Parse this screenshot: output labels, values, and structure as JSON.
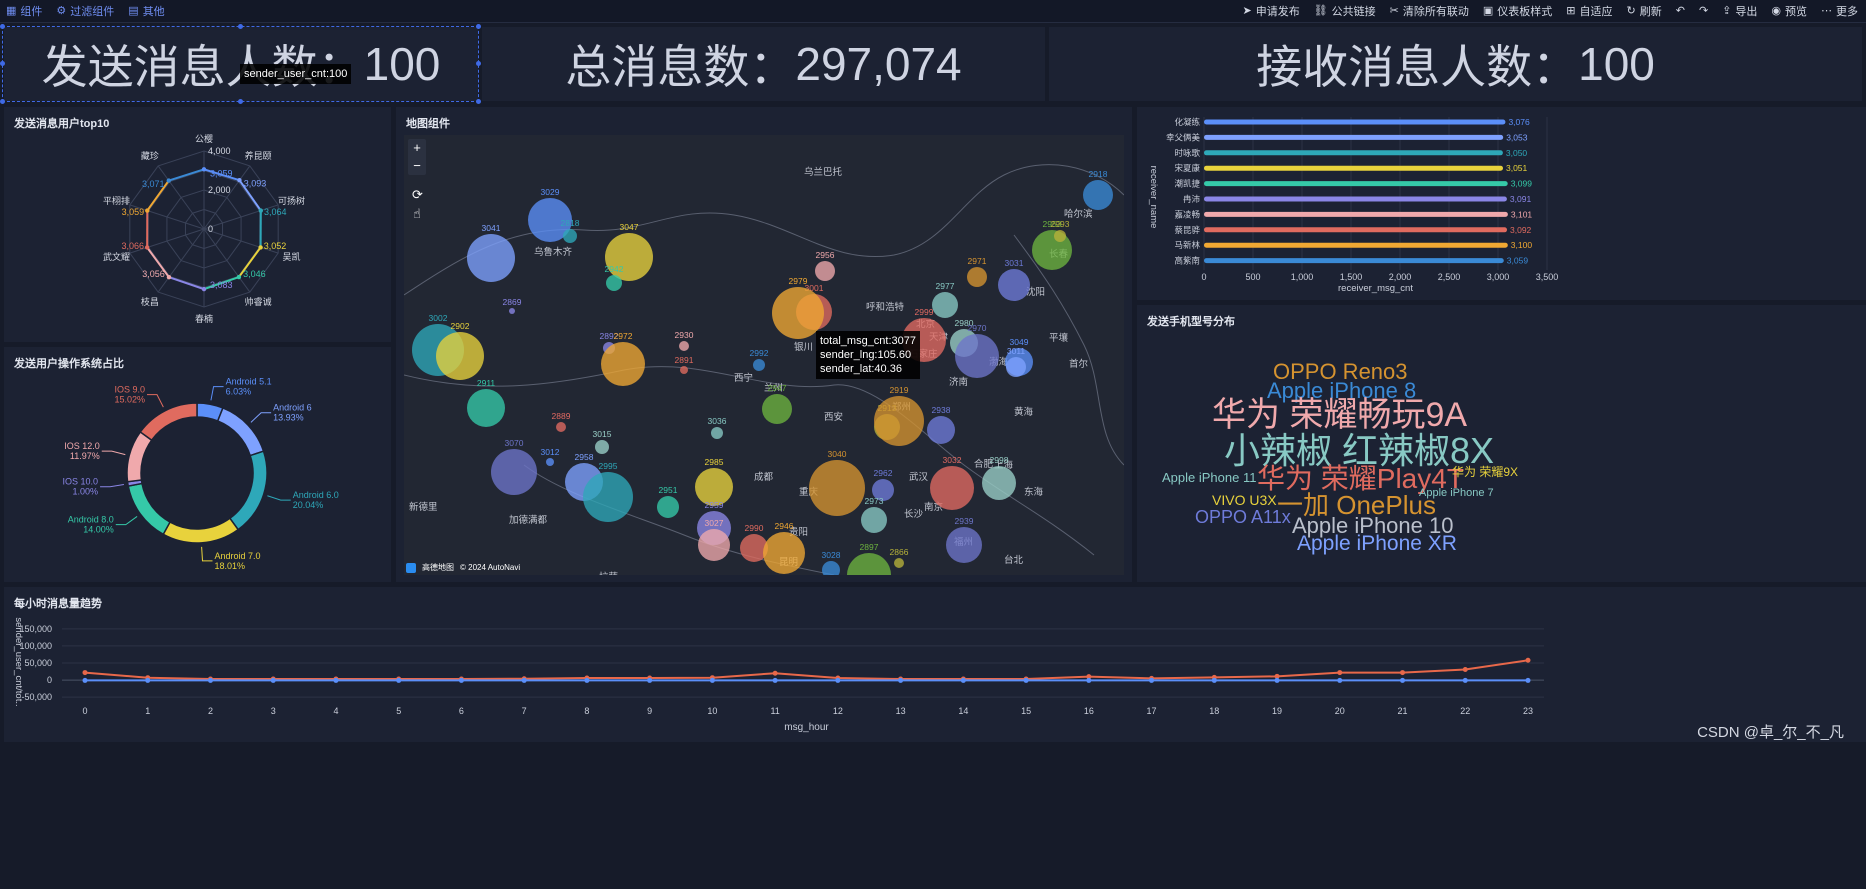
{
  "toolbar": {
    "left": [
      {
        "icon": "component-icon",
        "label": "组件"
      },
      {
        "icon": "filter-component-icon",
        "label": "过滤组件"
      },
      {
        "icon": "other-icon",
        "label": "其他"
      }
    ],
    "right": [
      {
        "icon": "send-icon",
        "label": "申请发布"
      },
      {
        "icon": "link-icon",
        "label": "公共链接"
      },
      {
        "icon": "unlink-icon",
        "label": "清除所有联动"
      },
      {
        "icon": "style-icon",
        "label": "仪表板样式"
      },
      {
        "icon": "fit-icon",
        "label": "自适应"
      },
      {
        "icon": "refresh-icon",
        "label": "刷新"
      },
      {
        "icon": "undo-icon",
        "label": ""
      },
      {
        "icon": "redo-icon",
        "label": ""
      },
      {
        "icon": "export-icon",
        "label": "导出"
      },
      {
        "icon": "preview-icon",
        "label": "预览"
      },
      {
        "icon": "more-icon",
        "label": "更多"
      }
    ]
  },
  "kpis": [
    {
      "label": "发送消息人数：",
      "value": "100"
    },
    {
      "label": "总消息数：",
      "value": "297,074"
    },
    {
      "label": "接收消息人数：",
      "value": "100"
    }
  ],
  "kpi_tooltip": "sender_user_cnt:100",
  "colors": {
    "accent": "#3f6ae6",
    "palette": [
      "#5b8ff9",
      "#7ea1ff",
      "#2ea8b9",
      "#e8d23c",
      "#35c9a8",
      "#8a86e6",
      "#f0a9ac",
      "#e06b5f",
      "#f0a833",
      "#3a8ad6"
    ]
  },
  "radar": {
    "title": "发送消息用户top10",
    "ticks": [
      "4,000",
      "2,000",
      "0"
    ],
    "chart_data": {
      "type": "radar",
      "categories": [
        "公樱",
        "养昆颐",
        "可扬树",
        "吴凯",
        "帅睿诚",
        "春楠",
        "枝昌",
        "武文耀",
        "平栩排",
        "藏珍"
      ],
      "values": [
        3059,
        3093,
        3064,
        3052,
        3046,
        3083,
        3056,
        3066,
        3059,
        3071
      ],
      "value_labels": [
        "3,059",
        "3,093",
        "3,064",
        "3,052",
        "3,046",
        "3,083",
        "3,056",
        "3,066",
        "3,059",
        "3,071"
      ],
      "max": 4000
    }
  },
  "donut": {
    "title": "发送用户操作系统占比",
    "chart_data": {
      "type": "pie",
      "categories": [
        "Android 5.1",
        "Android 6",
        "Android 6.0",
        "Android 7.0",
        "Android 8.0",
        "IOS 10.0",
        "IOS 12.0",
        "IOS 9.0"
      ],
      "percents": [
        "6.03%",
        "13.93%",
        "20.04%",
        "18.01%",
        "14.00%",
        "1.00%",
        "11.97%",
        "15.02%"
      ],
      "values": [
        6.03,
        13.93,
        20.04,
        18.01,
        14.0,
        1.0,
        11.97,
        15.02
      ],
      "colors": [
        "#5b8ff9",
        "#7ea1ff",
        "#2ea8b9",
        "#e8d23c",
        "#35c9a8",
        "#8a86e6",
        "#f0a9ac",
        "#e06b5f"
      ]
    }
  },
  "map": {
    "title": "地图组件",
    "zoom_in": "+",
    "zoom_out": "−",
    "copyright": "© 2024 AutoNavi",
    "logo_text": "高德地图",
    "tooltip": [
      "total_msg_cnt:3077",
      "sender_lng:105.60",
      "sender_lat:40.36"
    ],
    "places": [
      "乌兰巴托",
      "哈尔滨",
      "长春",
      "沈阳",
      "乌鲁木齐",
      "呼和浩特",
      "银川",
      "北京",
      "天津",
      "石家庄",
      "济南",
      "西宁",
      "兰州",
      "西安",
      "郑州",
      "武汉",
      "合肥",
      "南京",
      "上海",
      "成都",
      "重庆",
      "长沙",
      "贵阳",
      "昆明",
      "福州",
      "台北",
      "新德里",
      "加德满都",
      "平壤",
      "首尔",
      "黄海",
      "东海",
      "渤海",
      "拉萨"
    ],
    "bubble_labels": [
      "3029",
      "3041",
      "2818",
      "3047",
      "2942",
      "2869",
      "2956",
      "3001",
      "2979",
      "2918",
      "2953",
      "2993",
      "2971",
      "3031",
      "2977",
      "2999",
      "2980",
      "2970",
      "3049",
      "3011",
      "3002",
      "2902",
      "2911",
      "2892",
      "2930",
      "2891",
      "2972",
      "2992",
      "2947",
      "2913",
      "2919",
      "2938",
      "3036",
      "2889",
      "3015",
      "3070",
      "3012",
      "2958",
      "2995",
      "2985",
      "2951",
      "2959",
      "3027",
      "2990",
      "2946",
      "3028",
      "2897",
      "2866",
      "3040",
      "2962",
      "2973",
      "3032",
      "2998",
      "2939"
    ]
  },
  "hbar": {
    "x_ticks": [
      "0",
      "500",
      "1,000",
      "1,500",
      "2,000",
      "2,500",
      "3,000",
      "3,500"
    ],
    "chart_data": {
      "type": "bar",
      "orientation": "horizontal",
      "categories": [
        "化凝练",
        "幸父俩美",
        "时咏歌",
        "宋夏康",
        "潮凯捷",
        "冉沛",
        "嘉凌畅",
        "蔡昆骅",
        "马新林",
        "高紫南"
      ],
      "values": [
        3076,
        3053,
        3050,
        3051,
        3099,
        3091,
        3101,
        3092,
        3100,
        3059
      ],
      "value_labels": [
        "3,076",
        "3,053",
        "3,050",
        "3,051",
        "3,099",
        "3,091",
        "3,101",
        "3,092",
        "3,100",
        "3,059"
      ],
      "colors": [
        "#5b8ff9",
        "#7ea1ff",
        "#2ea8b9",
        "#e8d23c",
        "#35c9a8",
        "#8a86e6",
        "#f0a9ac",
        "#e06b5f",
        "#f0a833",
        "#3a8ad6"
      ],
      "xlabel": "receiver_msg_cnt",
      "ylabel": "receiver_name",
      "xlim": [
        0,
        3500
      ]
    }
  },
  "wordcloud": {
    "title": "发送手机型号分布",
    "words": [
      "OPPO Reno3",
      "Apple iPhone 8",
      "华为 荣耀畅玩9A",
      "小辣椒 红辣椒8X",
      "Apple iPhone 11",
      "华为 荣耀Play4T",
      "华为 荣耀9X",
      "Apple iPhone 7",
      "VIVO U3X",
      "一加 OnePlus",
      "OPPO A11x",
      "Apple iPhone 10",
      "Apple iPhone XR"
    ]
  },
  "line": {
    "title": "每小时消息量趋势",
    "y_ticks": [
      "150,000",
      "100,000",
      "50,000",
      "0",
      "-50,000"
    ],
    "watermark": "CSDN @卓_尔_不_凡",
    "chart_data": {
      "type": "line",
      "x": [
        0,
        1,
        2,
        3,
        4,
        5,
        6,
        7,
        8,
        9,
        10,
        11,
        12,
        13,
        14,
        15,
        16,
        17,
        18,
        19,
        20,
        21,
        22,
        23
      ],
      "series": [
        {
          "values": [
            22000,
            7000,
            3000,
            3000,
            3000,
            3000,
            3000,
            4000,
            6000,
            6000,
            7000,
            20000,
            6000,
            3000,
            3000,
            3000,
            10000,
            5000,
            8000,
            11000,
            22000,
            22000,
            31000,
            58000
          ],
          "color": "#e8684a"
        },
        {
          "values": [
            -1000,
            -1000,
            -1000,
            -1000,
            -1000,
            -1000,
            -1000,
            -1000,
            -1000,
            -1000,
            -1000,
            -1000,
            -1000,
            -1000,
            -1000,
            -1000,
            -1000,
            -1000,
            -1000,
            -1000,
            -1000,
            -1000,
            -1000,
            -1000
          ],
          "color": "#5b8ff9"
        }
      ],
      "xlabel": "msg_hour",
      "ylabel": "sender_user_cnt/tot..",
      "ylim": [
        -70000,
        170000
      ]
    }
  }
}
